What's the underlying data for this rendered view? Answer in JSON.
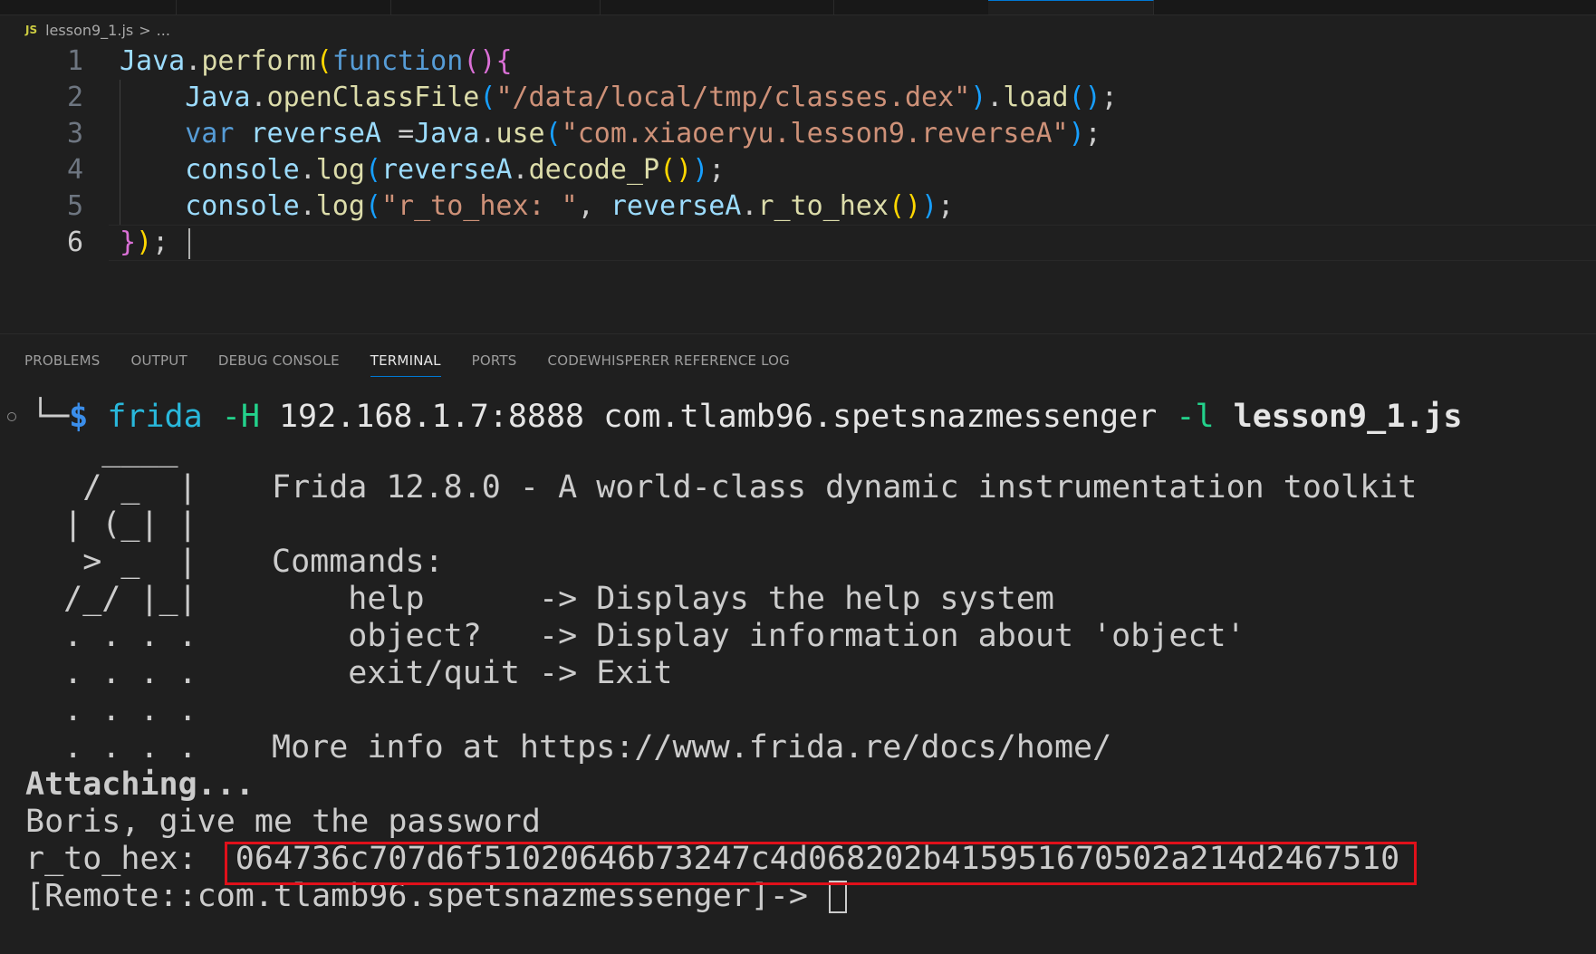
{
  "breadcrumb": {
    "lang_badge": "JS",
    "file": "lesson9_1.js",
    "separator": ">",
    "rest": "..."
  },
  "editor": {
    "lines": [
      {
        "n": "1"
      },
      {
        "n": "2"
      },
      {
        "n": "3"
      },
      {
        "n": "4"
      },
      {
        "n": "5"
      },
      {
        "n": "6"
      }
    ],
    "tokens": {
      "java": "Java",
      "perform": "perform",
      "function": "function",
      "openClassFile": "openClassFile",
      "dex_path": "\"/data/local/tmp/classes.dex\"",
      "load": "load",
      "var": "var",
      "reverseA": "reverseA",
      "use": "use",
      "class_name": "\"com.xiaoeryu.lesson9.reverseA\"",
      "console": "console",
      "log": "log",
      "decode_P": "decode_P",
      "r_to_hex_label": "\"r_to_hex: \"",
      "r_to_hex": "r_to_hex"
    }
  },
  "panel": {
    "tabs": [
      {
        "label": "PROBLEMS"
      },
      {
        "label": "OUTPUT"
      },
      {
        "label": "DEBUG CONSOLE"
      },
      {
        "label": "TERMINAL",
        "active": true
      },
      {
        "label": "PORTS"
      },
      {
        "label": "CODEWHISPERER REFERENCE LOG"
      }
    ]
  },
  "terminal": {
    "prompt_branch": "└─",
    "prompt_symbol": "$",
    "cmd": "frida",
    "flag_h": "-H",
    "host": "192.168.1.7:8888",
    "package": "com.tlamb96.spetsnazmessenger",
    "flag_l": "-l",
    "script": "lesson9_1.js",
    "logo": [
      "    ____",
      "   / _  |",
      "  | (_| |",
      "   > _  |",
      "  /_/ |_|",
      "  . . . .",
      "  . . . .",
      "  . . . .",
      "  . . . ."
    ],
    "banner": [
      "",
      "Frida 12.8.0 - A world-class dynamic instrumentation toolkit",
      "",
      "Commands:",
      "    help      -> Displays the help system",
      "    object?   -> Display information about 'object'",
      "    exit/quit -> Exit",
      "",
      "More info at https://www.frida.re/docs/home/"
    ],
    "attaching": "Attaching...",
    "output_line": "Boris, give me the password",
    "r_label": "r_to_hex: ",
    "r_value": "064736c707d6f51020646b73247c4d068202b415951670502a214d2467510",
    "remote_prompt": "[Remote::com.tlamb96.spetsnazmessenger]-> "
  },
  "colors": {
    "highlight_box": "#e0101a",
    "accent": "#0078d4"
  }
}
